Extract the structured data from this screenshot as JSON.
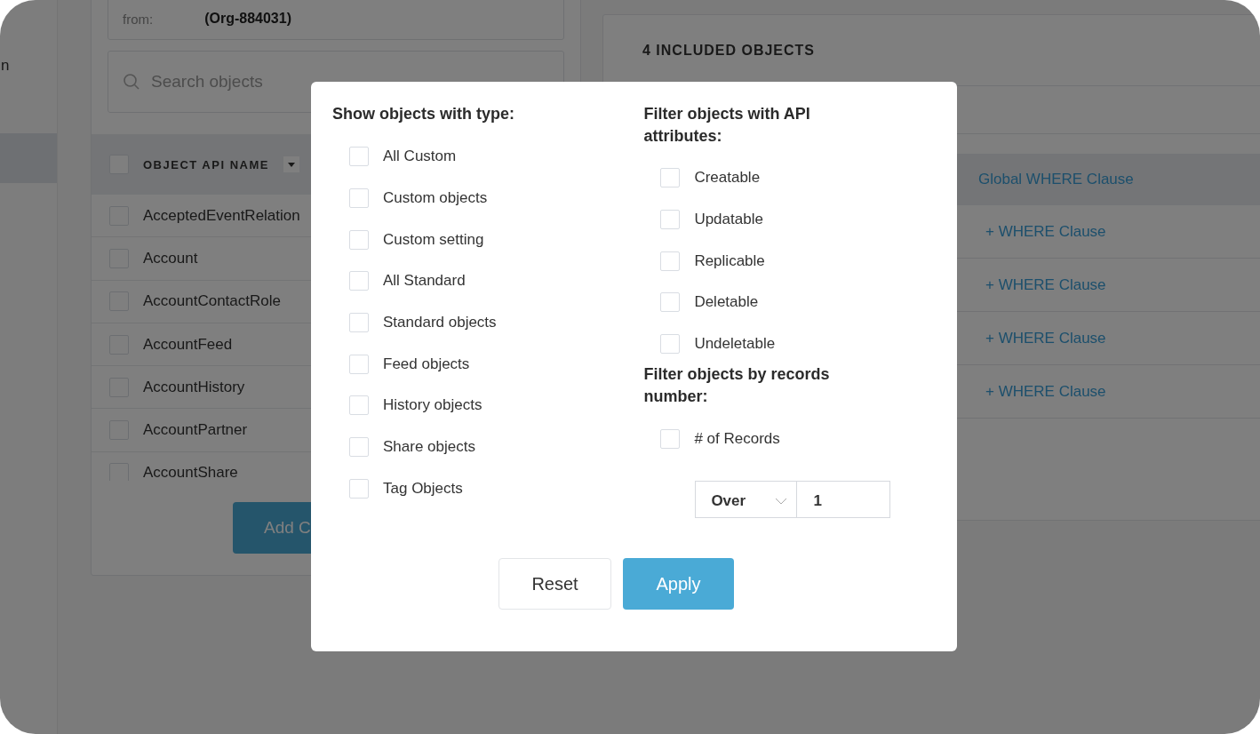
{
  "sidebar": {
    "fragment": "n"
  },
  "source": {
    "label": "from:",
    "value": "(Org-884031)"
  },
  "search": {
    "placeholder": "Search objects"
  },
  "objects_table": {
    "header": {
      "checked": false,
      "label": "OBJECT API NAME"
    },
    "rows": [
      {
        "name": "AcceptedEventRelation",
        "checked": false
      },
      {
        "name": "Account",
        "checked": false
      },
      {
        "name": "AccountContactRole",
        "checked": false
      },
      {
        "name": "AccountFeed",
        "checked": false
      },
      {
        "name": "AccountHistory",
        "checked": false
      },
      {
        "name": "AccountPartner",
        "checked": false
      },
      {
        "name": "AccountShare",
        "checked": false
      }
    ]
  },
  "add_button": "Add C",
  "included": {
    "title": "4 INCLUDED OBJECTS",
    "global_clause": "Global WHERE Clause",
    "rows": [
      "+ WHERE Clause",
      "+ WHERE Clause",
      "+ WHERE Clause",
      "+ WHERE Clause"
    ]
  },
  "filter_dialog": {
    "type_section": {
      "title": "Show objects with type:",
      "options": [
        {
          "label": "All Custom",
          "checked": false
        },
        {
          "label": "Custom objects",
          "checked": false
        },
        {
          "label": "Custom setting",
          "checked": false
        },
        {
          "label": "All Standard",
          "checked": false
        },
        {
          "label": "Standard objects",
          "checked": false
        },
        {
          "label": "Feed objects",
          "checked": false
        },
        {
          "label": "History objects",
          "checked": false
        },
        {
          "label": "Share objects",
          "checked": false
        },
        {
          "label": "Tag Objects",
          "checked": false
        }
      ]
    },
    "api_section": {
      "title": "Filter objects with API attributes:",
      "options": [
        {
          "label": "Creatable",
          "checked": false
        },
        {
          "label": "Updatable",
          "checked": false
        },
        {
          "label": "Replicable",
          "checked": false
        },
        {
          "label": "Deletable",
          "checked": false
        },
        {
          "label": "Undeletable",
          "checked": false
        }
      ]
    },
    "records_section": {
      "title": "Filter objects by records number:",
      "option": {
        "label": "# of Records",
        "checked": false
      },
      "operator": "Over",
      "value": "1"
    },
    "buttons": {
      "reset": "Reset",
      "apply": "Apply"
    }
  }
}
